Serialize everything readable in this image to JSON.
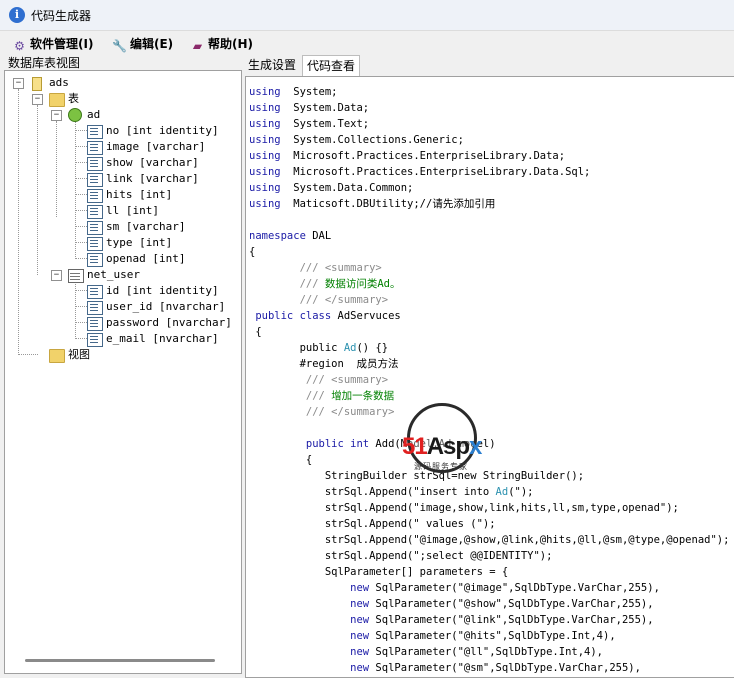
{
  "window": {
    "title": "代码生成器"
  },
  "menu": [
    {
      "label": "软件管理(I)",
      "icon": "gears-icon"
    },
    {
      "label": "编辑(E)",
      "icon": "wrench-icon"
    },
    {
      "label": "帮助(H)",
      "icon": "book-icon"
    }
  ],
  "left_panel": {
    "title": "数据库表视图"
  },
  "tree": {
    "db": "ads",
    "tables_folder": "表",
    "tables": [
      {
        "name": "ad",
        "columns": [
          "no  [int identity]",
          "image  [varchar]",
          "show  [varchar]",
          "link  [varchar]",
          "hits  [int]",
          "ll  [int]",
          "sm  [varchar]",
          "type  [int]",
          "openad  [int]"
        ]
      },
      {
        "name": "net_user",
        "columns": [
          "id  [int identity]",
          "user_id  [nvarchar]",
          "password  [nvarchar]",
          "e_mail  [nvarchar]"
        ]
      }
    ],
    "views_folder": "视图"
  },
  "tabs": [
    {
      "label": "生成设置",
      "active": false
    },
    {
      "label": "代码查看",
      "active": true
    }
  ],
  "code_lines": [
    [
      [
        "k",
        "using"
      ],
      [
        "",
        "  System;"
      ]
    ],
    [
      [
        "k",
        "using"
      ],
      [
        "",
        "  System.Data;"
      ]
    ],
    [
      [
        "k",
        "using"
      ],
      [
        "",
        "  System.Text;"
      ]
    ],
    [
      [
        "k",
        "using"
      ],
      [
        "",
        "  System.Collections.Generic;"
      ]
    ],
    [
      [
        "k",
        "using"
      ],
      [
        "",
        "  Microsoft.Practices.EnterpriseLibrary.Data;"
      ]
    ],
    [
      [
        "k",
        "using"
      ],
      [
        "",
        "  Microsoft.Practices.EnterpriseLibrary.Data.Sql;"
      ]
    ],
    [
      [
        "k",
        "using"
      ],
      [
        "",
        "  System.Data.Common;"
      ]
    ],
    [
      [
        "k",
        "using"
      ],
      [
        "",
        "  Maticsoft.DBUtility;//请先添加引用"
      ]
    ],
    [],
    [
      [
        "k",
        "namespace"
      ],
      [
        "",
        " DAL"
      ]
    ],
    [
      [
        "",
        "{"
      ]
    ],
    [
      [
        "c",
        "        /// <summary>"
      ]
    ],
    [
      [
        "c",
        "        /// "
      ],
      [
        "g",
        "数据访问类Ad。"
      ]
    ],
    [
      [
        "c",
        "        /// </summary>"
      ]
    ],
    [
      [
        "k",
        " public class"
      ],
      [
        "",
        " AdServuces"
      ]
    ],
    [
      [
        "",
        " {"
      ]
    ],
    [
      [
        "",
        "        public "
      ],
      [
        "ty",
        "Ad"
      ],
      [
        "",
        "() {}"
      ]
    ],
    [
      [
        "",
        "        #region  成员方法"
      ]
    ],
    [
      [
        "c",
        "         /// <summary>"
      ]
    ],
    [
      [
        "c",
        "         /// "
      ],
      [
        "g",
        "增加一条数据"
      ]
    ],
    [
      [
        "c",
        "         /// </summary>"
      ]
    ],
    [],
    [
      [
        "k",
        "         public int"
      ],
      [
        "",
        " Add(Model.Ad model)"
      ]
    ],
    [
      [
        "",
        "         {"
      ]
    ],
    [
      [
        "",
        "            StringBuilder strSql=new StringBuilder();"
      ]
    ],
    [
      [
        "",
        "            strSql.Append(\"insert into "
      ],
      [
        "ty",
        "Ad"
      ],
      [
        "",
        "(\");"
      ]
    ],
    [
      [
        "",
        "            strSql.Append(\"image,show,link,hits,ll,sm,type,openad\");"
      ]
    ],
    [
      [
        "",
        "            strSql.Append(\" values (\");"
      ]
    ],
    [
      [
        "",
        "            strSql.Append(\"@image,@show,@link,@hits,@ll,@sm,@type,@openad\");"
      ]
    ],
    [
      [
        "",
        "            strSql.Append(\";select @@IDENTITY\");"
      ]
    ],
    [
      [
        "",
        "            SqlParameter[] parameters = {"
      ]
    ],
    [
      [
        "k",
        "                new"
      ],
      [
        "",
        " SqlParameter(\"@image\",SqlDbType.VarChar,255),"
      ]
    ],
    [
      [
        "k",
        "                new"
      ],
      [
        "",
        " SqlParameter(\"@show\",SqlDbType.VarChar,255),"
      ]
    ],
    [
      [
        "k",
        "                new"
      ],
      [
        "",
        " SqlParameter(\"@link\",SqlDbType.VarChar,255),"
      ]
    ],
    [
      [
        "k",
        "                new"
      ],
      [
        "",
        " SqlParameter(\"@hits\",SqlDbType.Int,4),"
      ]
    ],
    [
      [
        "k",
        "                new"
      ],
      [
        "",
        " SqlParameter(\"@ll\",SqlDbType.Int,4),"
      ]
    ],
    [
      [
        "k",
        "                new"
      ],
      [
        "",
        " SqlParameter(\"@sm\",SqlDbType.VarChar,255),"
      ]
    ]
  ],
  "watermark": {
    "brand_red": "51",
    "brand_black": "Asp",
    "brand_blue": "x",
    "subtitle": "源码服务专家"
  }
}
